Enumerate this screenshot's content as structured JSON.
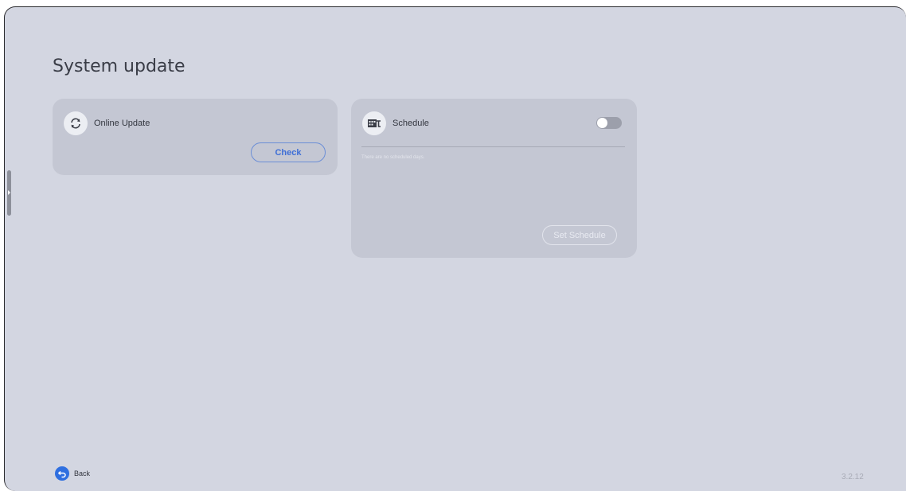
{
  "page": {
    "title": "System update",
    "version": "3.2.12"
  },
  "online_update": {
    "label": "Online Update",
    "icon": "sync-icon",
    "check_label": "Check"
  },
  "schedule": {
    "label": "Schedule",
    "icon": "calendar-icon",
    "toggle_on": false,
    "empty_text": "There are no scheduled days.",
    "set_label": "Set Schedule"
  },
  "footer": {
    "back_label": "Back",
    "back_icon": "back-arrow-icon"
  },
  "colors": {
    "background": "#d3d6e1",
    "card": "#c4c7d3",
    "accent": "#2f6fe0"
  }
}
